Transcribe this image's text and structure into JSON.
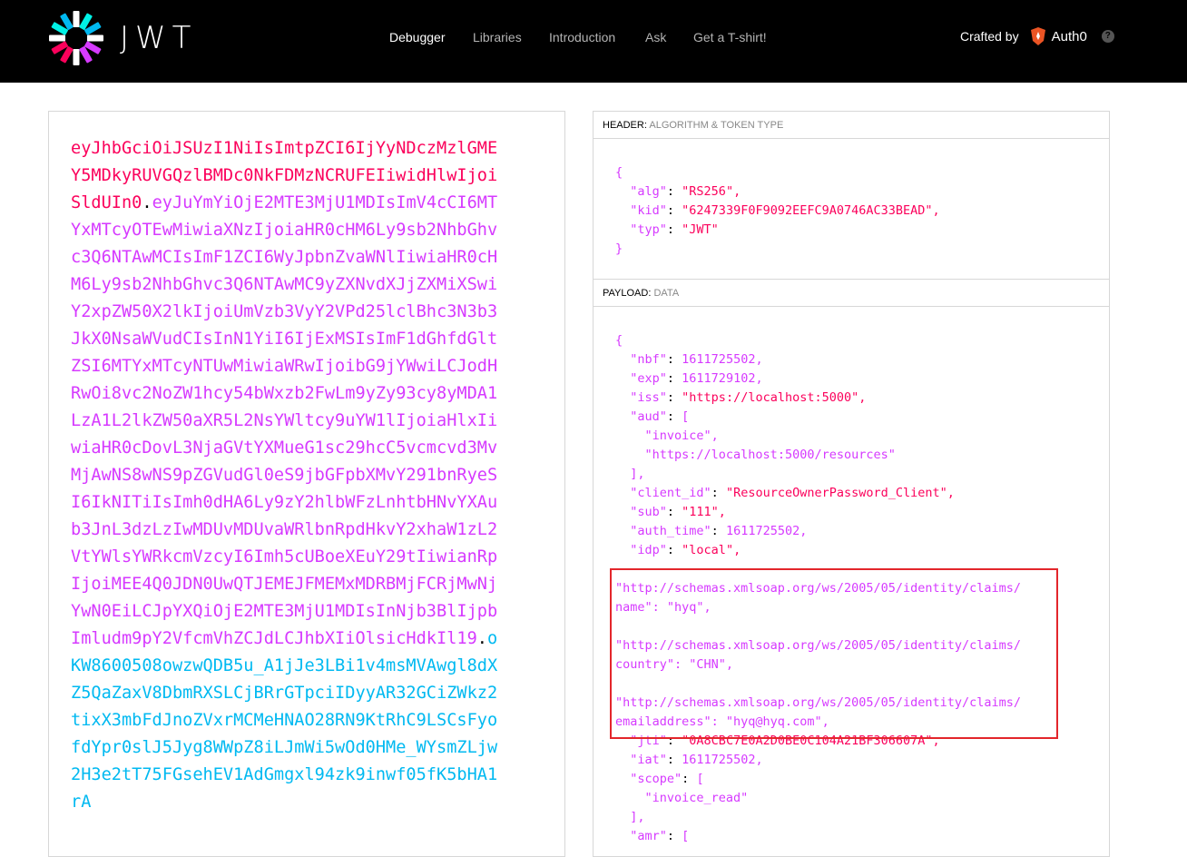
{
  "brand": {
    "name": "JWT"
  },
  "nav": {
    "items": [
      {
        "label": "Debugger",
        "active": true
      },
      {
        "label": "Libraries",
        "active": false
      },
      {
        "label": "Introduction",
        "active": false
      },
      {
        "label": "Ask",
        "active": false
      },
      {
        "label": "Get a T-shirt!",
        "active": false
      }
    ]
  },
  "crafted": {
    "label": "Crafted by",
    "company": "Auth0",
    "help": "?"
  },
  "token": {
    "header": "eyJhbGciOiJSUzI1NiIsImtpZCI6IjYyNDczMzlGMEY5MDkyRUVGQzlBMDc0NkFDMzNCRUFEIiwidHlwIjoiSldUIn0",
    "dot1": ".",
    "payload": "eyJuYmYiOjE2MTE3MjU1MDIsImV4cCI6MTYxMTcyOTEwMiwiaXNzIjoiaHR0cHM6Ly9sb2NhbGhvc3Q6NTAwMCIsImF1ZCI6WyJpbnZvaWNlIiwiaHR0cHM6Ly9sb2NhbGhvc3Q6NTAwMC9yZXNvdXJjZXMiXSwiY2xpZW50X2lkIjoiUmVzb3VyY2VPd25lclBhc3N3b3JkX0NsaWVudCIsInN1YiI6IjExMSIsImF1dGhfdGltZSI6MTYxMTcyNTUwMiwiaWRwIjoibG9jYWwiLCJodHRwOi8vc2NoZW1hcy54bWxzb2FwLm9yZy93cy8yMDA1LzA1L2lkZW50aXR5L2NsYWltcy9uYW1lIjoiaHlxIiwiaHR0cDovL3NjaGVtYXMueG1sc29hcC5vcmcvd3MvMjAwNS8wNS9pZGVudGl0eS9jbGFpbXMvY291bnRyeSI6IkNITiIsImh0dHA6Ly9zY2hlbWFzLnhtbHNvYXAub3JnL3dzLzIwMDUvMDUvaWRlbnRpdHkvY2xhaW1zL2VtYWlsYWRkcmVzcyI6Imh5cUBoeXEuY29tIiwianRpIjoiMEE4Q0JDN0UwQTJEMEJFMEMxMDRBMjFCRjMwNjYwN0EiLCJpYXQiOjE2MTE3MjU1MDIsInNjb3BlIjpbImludm9pY2VfcmVhZCJdLCJhbXIiOlsicHdkIl19",
    "dot2": ".",
    "signature": "oKW8600508owzwQDB5u_A1jJe3LBi1v4msMVAwgl8dXZ5QaZaxV8DbmRXSLCjBRrGTpciIDyyAR32GCiZWkz2tixX3mbFdJnoZVxrMCMeHNAO28RN9KtRhC9LSCsFyofdYpr0slJ5Jyg8WWpZ8iLJmWi5wOd0HMe_WYsmZLjw2H3e2tT75FGsehEV1AdGmgxl94zk9inwf05fK5bHA1rA"
  },
  "header_section": {
    "title": "HEADER:",
    "subtitle": "ALGORITHM & TOKEN TYPE",
    "lines": [
      "{",
      "  \"alg\": \"RS256\",",
      "  \"kid\": \"6247339F0F9092EEFC9A0746AC33BEAD\",",
      "  \"typ\": \"JWT\"",
      "}"
    ]
  },
  "payload_section": {
    "title": "PAYLOAD:",
    "subtitle": "DATA",
    "lines": [
      "{",
      "  \"nbf\": 1611725502,",
      "  \"exp\": 1611729102,",
      "  \"iss\": \"https://localhost:5000\",",
      "  \"aud\": [",
      "    \"invoice\",",
      "    \"https://localhost:5000/resources\"",
      "  ],",
      "  \"client_id\": \"ResourceOwnerPassword_Client\",",
      "  \"sub\": \"111\",",
      "  \"auth_time\": 1611725502,",
      "  \"idp\": \"local\",",
      "",
      "\"http://schemas.xmlsoap.org/ws/2005/05/identity/claims/",
      "name\": \"hyq\",",
      "",
      "\"http://schemas.xmlsoap.org/ws/2005/05/identity/claims/",
      "country\": \"CHN\",",
      "",
      "\"http://schemas.xmlsoap.org/ws/2005/05/identity/claims/",
      "emailaddress\": \"hyq@hyq.com\",",
      "  \"jti\": \"0A8CBC7E0A2D0BE0C104A21BF306607A\",",
      "  \"iat\": 1611725502,",
      "  \"scope\": [",
      "    \"invoice_read\"",
      "  ],",
      "  \"amr\": ["
    ]
  }
}
